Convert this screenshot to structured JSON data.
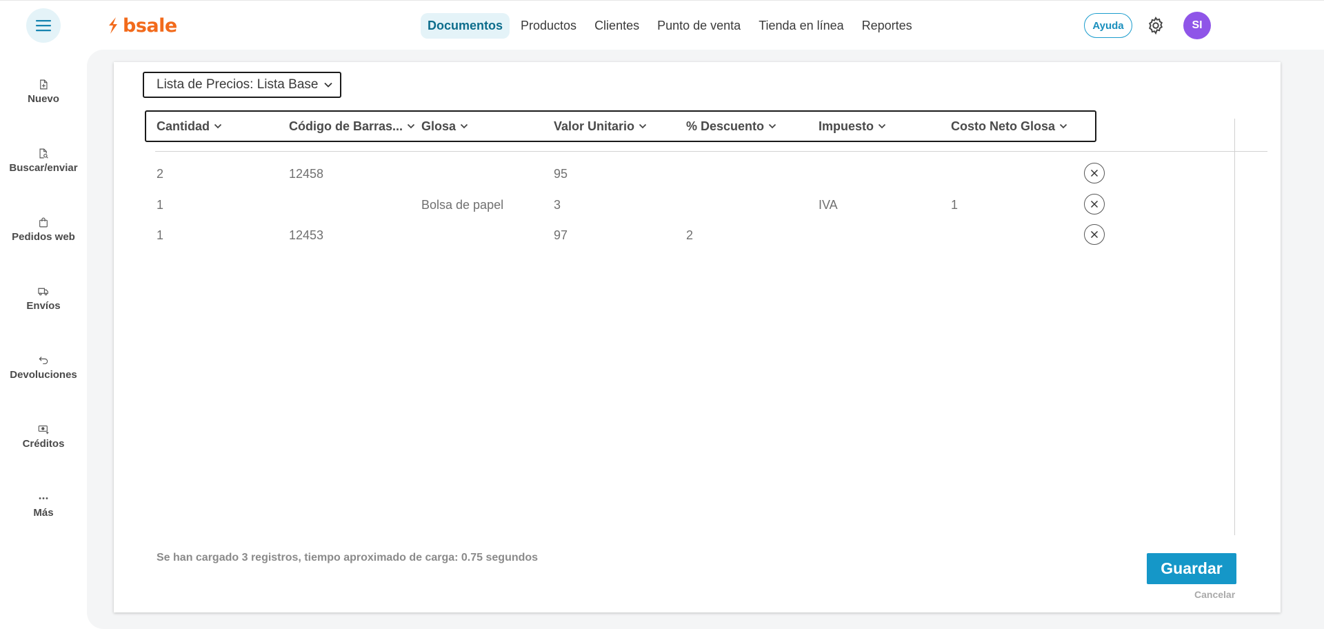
{
  "app": {
    "logo_text": "bsale",
    "brand_color": "#f26a1b",
    "accent_color": "#1597c8"
  },
  "header": {
    "nav": [
      {
        "label": "Documentos",
        "active": true
      },
      {
        "label": "Productos",
        "active": false
      },
      {
        "label": "Clientes",
        "active": false
      },
      {
        "label": "Punto de venta",
        "active": false
      },
      {
        "label": "Tienda en línea",
        "active": false
      },
      {
        "label": "Reportes",
        "active": false
      }
    ],
    "help_label": "Ayuda",
    "avatar_initials": "SI",
    "icons": {
      "menu": "hamburger-icon",
      "settings": "gear-icon"
    }
  },
  "sidebar": {
    "items": [
      {
        "label": "Nuevo",
        "icon": "file-plus-icon"
      },
      {
        "label": "Buscar/enviar",
        "icon": "file-search-icon"
      },
      {
        "label": "Pedidos web",
        "icon": "shopping-bag-icon"
      },
      {
        "label": "Envíos",
        "icon": "truck-icon"
      },
      {
        "label": "Devoluciones",
        "icon": "return-arrow-icon"
      },
      {
        "label": "Créditos",
        "icon": "money-plus-icon"
      },
      {
        "label": "Más",
        "icon": "more-dots-icon"
      }
    ]
  },
  "main": {
    "price_list_label": "Lista de Precios: Lista Base",
    "columns": [
      "Cantidad",
      "Código de Barras...",
      "Glosa",
      "Valor Unitario",
      "% Descuento",
      "Impuesto",
      "Costo Neto Glosa"
    ],
    "rows": [
      [
        "2",
        "12458",
        "",
        "95",
        "",
        "",
        ""
      ],
      [
        "1",
        "",
        "Bolsa de papel",
        "3",
        "",
        "IVA",
        "1"
      ],
      [
        "1",
        "12453",
        "",
        "97",
        "2",
        "",
        ""
      ]
    ],
    "status_text": "Se han cargado 3 registros, tiempo aproximado de carga: 0.75 segundos",
    "save_label": "Guardar",
    "cancel_label": "Cancelar"
  }
}
